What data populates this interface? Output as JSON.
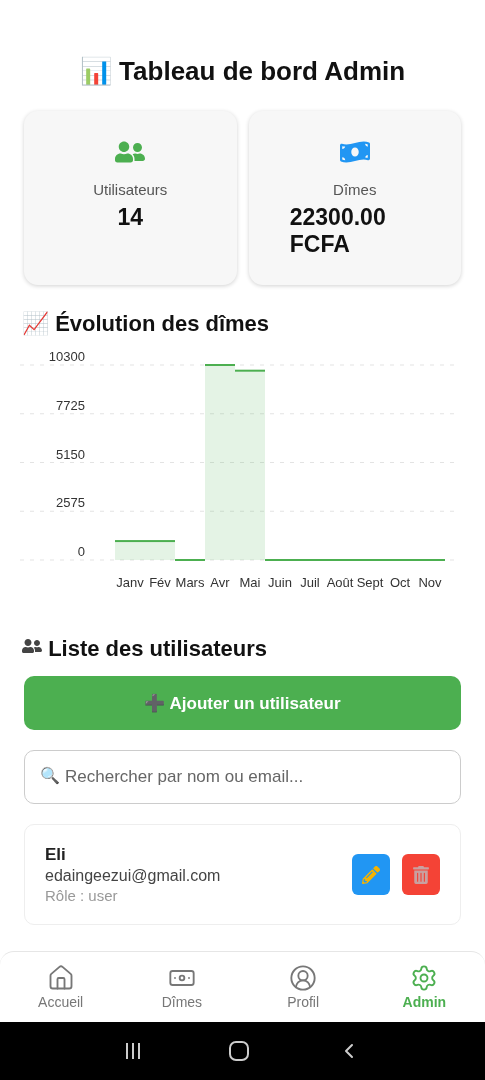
{
  "title": {
    "icon": "📊",
    "text": "Tableau de bord Admin"
  },
  "stats": [
    {
      "kind": "users",
      "label": "Utilisateurs",
      "value": "14"
    },
    {
      "kind": "money",
      "label": "Dîmes",
      "value": "22300.00 FCFA"
    }
  ],
  "chart_section": {
    "icon": "📈",
    "title": "Évolution des dîmes",
    "chart_data": {
      "type": "bar",
      "categories": [
        "Janv",
        "Fév",
        "Mars",
        "Avr",
        "Mai",
        "Juin",
        "Juil",
        "Août",
        "Sept",
        "Oct",
        "Nov"
      ],
      "series": [
        {
          "color": "#4caf50",
          "values": [
            1000,
            1000,
            0,
            10300,
            10000,
            0,
            0,
            0,
            0,
            0,
            0
          ]
        }
      ],
      "grid": true,
      "ylim": [
        0,
        10300
      ],
      "yticks": [
        0,
        2575,
        5150,
        7725,
        10300
      ]
    }
  },
  "users_section": {
    "title": "Liste des utilisateurs",
    "add_button": {
      "icon": "➕",
      "label": "Ajouter un utilisateur"
    },
    "search": {
      "icon": "🔍",
      "placeholder": "Rechercher par nom ou email..."
    },
    "users": [
      {
        "name": "Eli",
        "email": "edaingeezui@gmail.com",
        "role": "Rôle : user"
      }
    ]
  },
  "nav": [
    {
      "kind": "home",
      "label": "Accueil",
      "selected": false
    },
    {
      "kind": "money",
      "label": "Dîmes",
      "selected": false
    },
    {
      "kind": "profile",
      "label": "Profil",
      "selected": false
    },
    {
      "kind": "settings",
      "label": "Admin",
      "selected": true
    }
  ]
}
